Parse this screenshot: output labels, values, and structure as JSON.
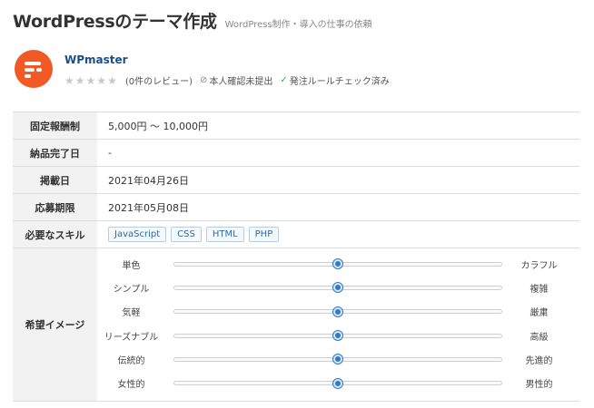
{
  "page": {
    "title": "WordPressのテーマ作成",
    "subtitle": "WordPress制作・導入の仕事の依頼"
  },
  "client": {
    "name": "WPmaster",
    "rating_stars": 0,
    "review_count": "(0件のレビュー)",
    "identity_badge": "本人確認未提出",
    "rule_badge": "発注ルールチェック済み",
    "avatar_color": "#f15a24"
  },
  "details": {
    "fee_label": "固定報酬制",
    "fee_value": "5,000円 ～ 10,000円",
    "delivery_label": "納品完了日",
    "delivery_value": "-",
    "posted_label": "掲載日",
    "posted_value": "2021年04月26日",
    "deadline_label": "応募期限",
    "deadline_value": "2021年05月08日",
    "skills_label": "必要なスキル",
    "skills": [
      "JavaScript",
      "CSS",
      "HTML",
      "PHP"
    ],
    "image_label": "希望イメージ"
  },
  "image_sliders": [
    {
      "left": "単色",
      "right": "カラフル",
      "value": 0.5
    },
    {
      "left": "シンプル",
      "right": "複雑",
      "value": 0.5
    },
    {
      "left": "気軽",
      "right": "厳粛",
      "value": 0.5
    },
    {
      "left": "リーズナブル",
      "right": "高級",
      "value": 0.5
    },
    {
      "left": "伝統的",
      "right": "先進的",
      "value": 0.5
    },
    {
      "left": "女性的",
      "right": "男性的",
      "value": 0.5
    }
  ],
  "colors": {
    "accent": "#2f7ac9",
    "link": "#1a4f8b",
    "check": "#3aa655"
  }
}
